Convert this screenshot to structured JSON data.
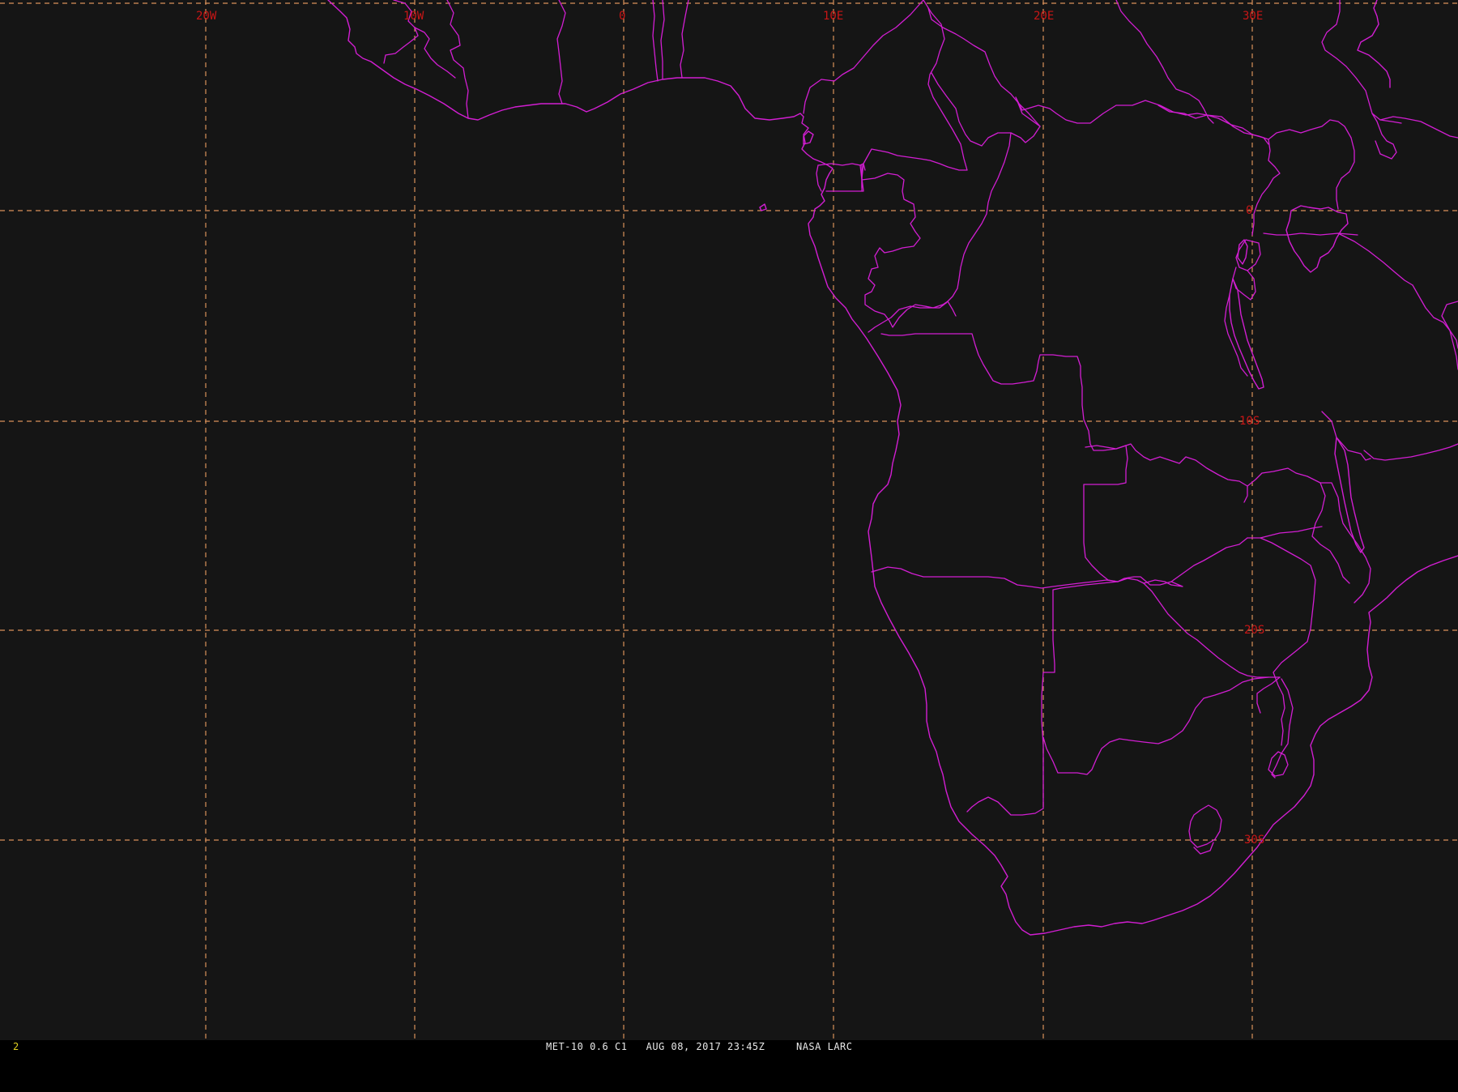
{
  "map": {
    "background_color": "#151515",
    "boundary_color": "#d21ed2",
    "gridline_color": "#d9915a",
    "grid_label_color": "#c81616",
    "longitude_labels": [
      "20W",
      "10W",
      "0",
      "10E",
      "20E",
      "30E"
    ],
    "latitude_labels": [
      "0",
      "10S",
      "20S",
      "30S"
    ]
  },
  "status_bar": {
    "frame_number": "2",
    "satellite": "MET-10",
    "channel": "0.6 C1",
    "date": "AUG 08, 2017",
    "time": "23:45Z",
    "source": "NASA LARC",
    "caption": "MET-10 0.6 C1   AUG 08, 2017 23:45Z     NASA LARC",
    "frame_number_color": "#e0d020",
    "caption_color": "#e8e8e8"
  }
}
